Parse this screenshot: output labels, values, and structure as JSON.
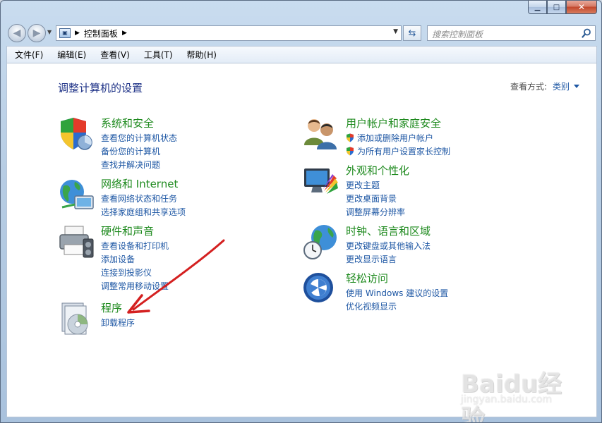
{
  "window": {
    "caption_buttons": [
      "minimize",
      "maximize",
      "close"
    ]
  },
  "address": {
    "path": "控制面板",
    "search_placeholder": "搜索控制面板"
  },
  "menu": {
    "items": [
      {
        "label": "文件(F)"
      },
      {
        "label": "编辑(E)"
      },
      {
        "label": "查看(V)"
      },
      {
        "label": "工具(T)"
      },
      {
        "label": "帮助(H)"
      }
    ]
  },
  "content": {
    "heading": "调整计算机的设置",
    "view_by_label": "查看方式:",
    "view_by_value": "类别"
  },
  "categories": {
    "system": {
      "icon": "shield-icon",
      "title": "系统和安全",
      "links": [
        "查看您的计算机状态",
        "备份您的计算机",
        "查找并解决问题"
      ]
    },
    "network": {
      "icon": "network-globe-icon",
      "title": "网络和 Internet",
      "links": [
        "查看网络状态和任务",
        "选择家庭组和共享选项"
      ]
    },
    "hardware": {
      "icon": "printer-icon",
      "title": "硬件和声音",
      "links": [
        "查看设备和打印机",
        "添加设备",
        "连接到投影仪",
        "调整常用移动设置"
      ]
    },
    "programs": {
      "icon": "programs-disc-icon",
      "title": "程序",
      "links": [
        "卸载程序"
      ]
    },
    "users": {
      "icon": "users-icon",
      "title": "用户帐户和家庭安全",
      "links": [
        "添加或删除用户帐户",
        "为所有用户设置家长控制"
      ]
    },
    "appearance": {
      "icon": "monitor-palette-icon",
      "title": "外观和个性化",
      "links": [
        "更改主题",
        "更改桌面背景",
        "调整屏幕分辨率"
      ]
    },
    "clock": {
      "icon": "clock-globe-icon",
      "title": "时钟、语言和区域",
      "links": [
        "更改键盘或其他输入法",
        "更改显示语言"
      ]
    },
    "ease": {
      "icon": "ease-of-access-icon",
      "title": "轻松访问",
      "links": [
        "使用 Windows 建议的设置",
        "优化视频显示"
      ]
    }
  },
  "watermark": {
    "brand": "Baidu经验",
    "url": "jingyan.baidu.com"
  },
  "colors": {
    "category_title": "#1e8a1e",
    "link": "#1e57a4",
    "heading": "#1e3287",
    "annotation_arrow": "#d42020"
  }
}
